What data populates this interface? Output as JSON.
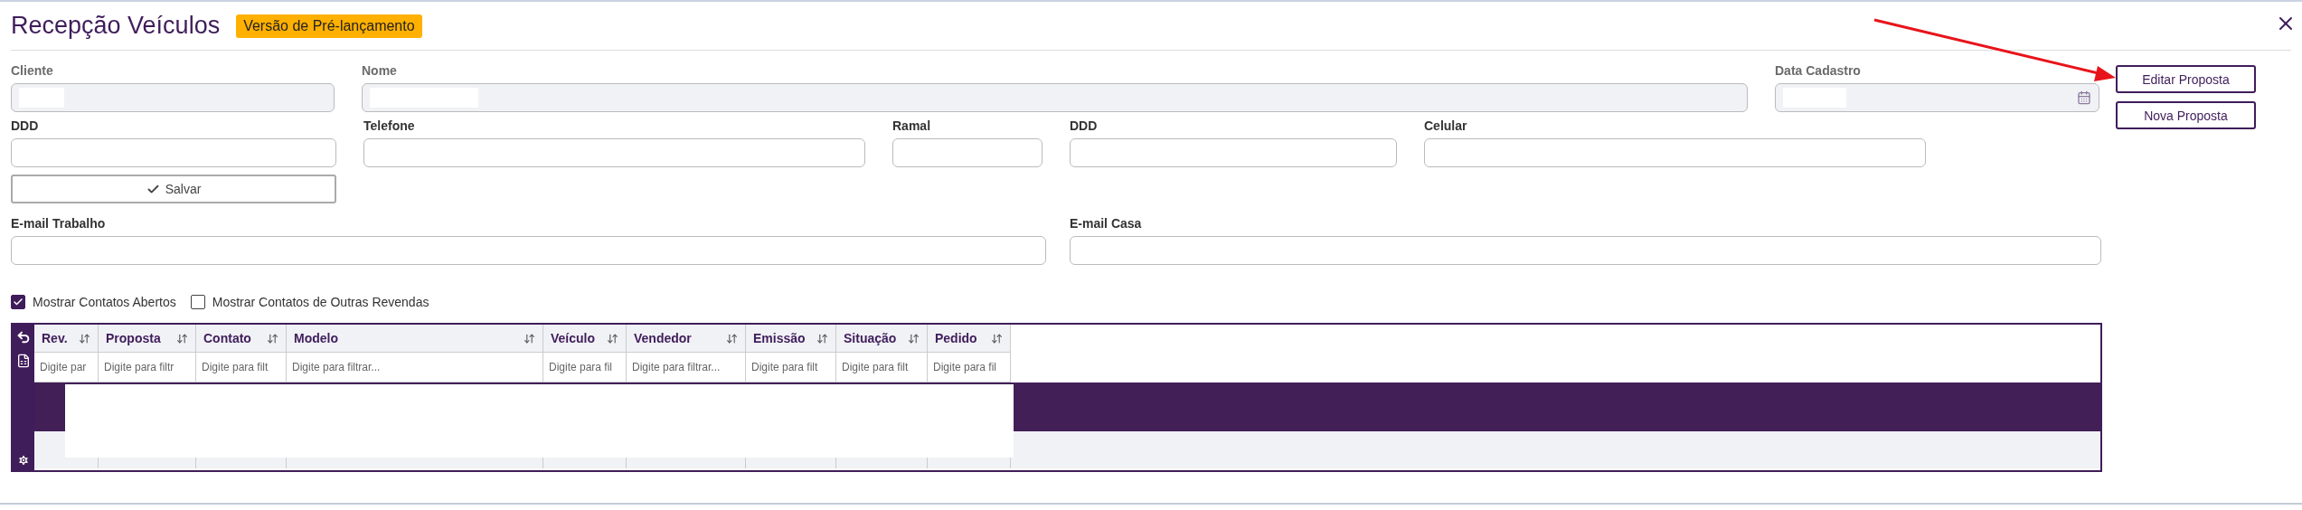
{
  "header": {
    "title": "Recepção Veículos",
    "badge": "Versão de Pré-lançamento"
  },
  "form_rows": [
    [
      {
        "label": "Cliente",
        "disabled": true,
        "redacted": true
      },
      {
        "label": "Nome",
        "disabled": true,
        "redacted": true
      },
      {
        "label": "Data Cadastro",
        "disabled": true,
        "redacted": true,
        "kind": "date"
      }
    ],
    [
      {
        "label": "DDD",
        "disabled": false
      },
      {
        "label": "Telefone",
        "disabled": false
      },
      {
        "label": "Ramal",
        "disabled": false
      },
      {
        "label": "DDD",
        "disabled": false
      },
      {
        "label": "Celular",
        "disabled": false
      }
    ]
  ],
  "save_button": "Salvar",
  "email_row": [
    {
      "label": "E-mail Trabalho",
      "disabled": false
    },
    {
      "label": "E-mail Casa",
      "disabled": false
    }
  ],
  "side_buttons": [
    "Editar Proposta",
    "Nova Proposta"
  ],
  "checkboxes": [
    {
      "label": "Mostrar Contatos Abertos",
      "checked": true
    },
    {
      "label": "Mostrar Contatos de Outras Revendas",
      "checked": false
    }
  ],
  "table": {
    "columns": [
      {
        "label": "Rev.",
        "filter_placeholder": "Digite par"
      },
      {
        "label": "Proposta",
        "filter_placeholder": "Digite para filtr"
      },
      {
        "label": "Contato",
        "filter_placeholder": "Digite para filt"
      },
      {
        "label": "Modelo",
        "filter_placeholder": "Digite para filtrar..."
      },
      {
        "label": "Veículo",
        "filter_placeholder": "Digite para fil"
      },
      {
        "label": "Vendedor",
        "filter_placeholder": "Digite para filtrar..."
      },
      {
        "label": "Emissão",
        "filter_placeholder": "Digite para filt"
      },
      {
        "label": "Situação",
        "filter_placeholder": "Digite para filt"
      },
      {
        "label": "Pedido",
        "filter_placeholder": "Digite para fil"
      }
    ],
    "rows": [
      {
        "selected": true
      },
      {
        "selected": false
      }
    ],
    "redacted": true
  }
}
